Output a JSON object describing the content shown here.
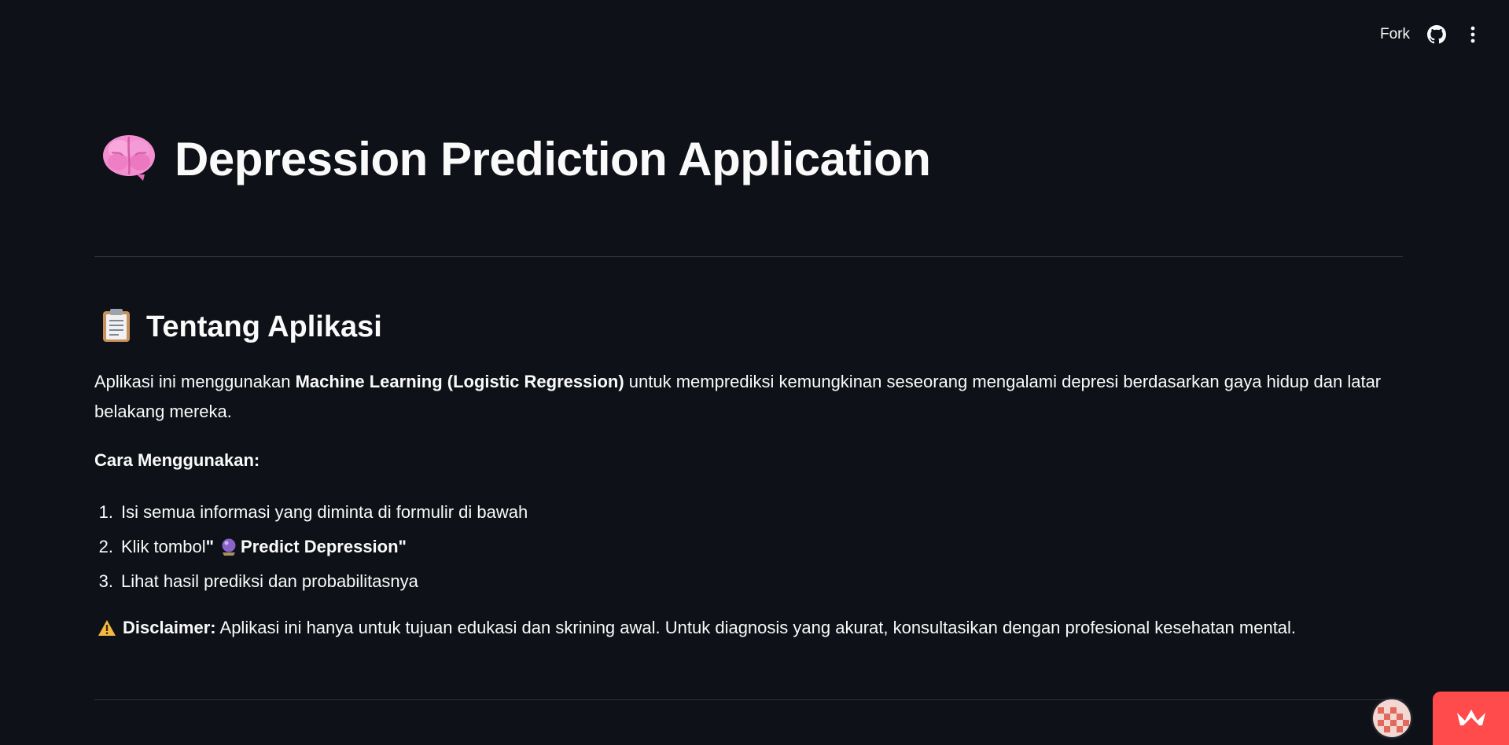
{
  "toolbar": {
    "fork_label": "Fork",
    "github_icon": "github-icon",
    "menu_icon": "vertical-dots-icon"
  },
  "header": {
    "icon": "brain-icon",
    "title": "Depression Prediction Application"
  },
  "about": {
    "icon": "clipboard-icon",
    "title": "Tentang Aplikasi",
    "intro_prefix": "Aplikasi ini menggunakan ",
    "intro_bold": "Machine Learning (Logistic Regression)",
    "intro_suffix": " untuk memprediksi kemungkinan seseorang mengalami depresi berdasarkan gaya hidup dan latar belakang mereka.",
    "how_to_title": "Cara Menggunakan:",
    "steps": [
      {
        "num": "1.",
        "text": "Isi semua informasi yang diminta di formulir di bawah"
      },
      {
        "num": "2.",
        "prefix": "Klik tombol ",
        "bold_open": "\"",
        "bold_text": " Predict Depression\""
      },
      {
        "num": "3.",
        "text": "Lihat hasil prediksi dan probabilitasnya"
      }
    ],
    "disclaimer_icon": "warning-icon",
    "disclaimer_label": "Disclaimer:",
    "disclaimer_text": " Aplikasi ini hanya untuk tujuan edukasi dan skrining awal. Untuk diagnosis yang akurat, konsultasikan dengan profesional kesehatan mental."
  },
  "colors": {
    "background": "#0e1117",
    "text": "#fafafa",
    "divider": "#31333f",
    "accent": "#ff4b4b"
  },
  "footer": {
    "avatar_icon": "user-avatar",
    "badge_icon": "crown-icon"
  }
}
